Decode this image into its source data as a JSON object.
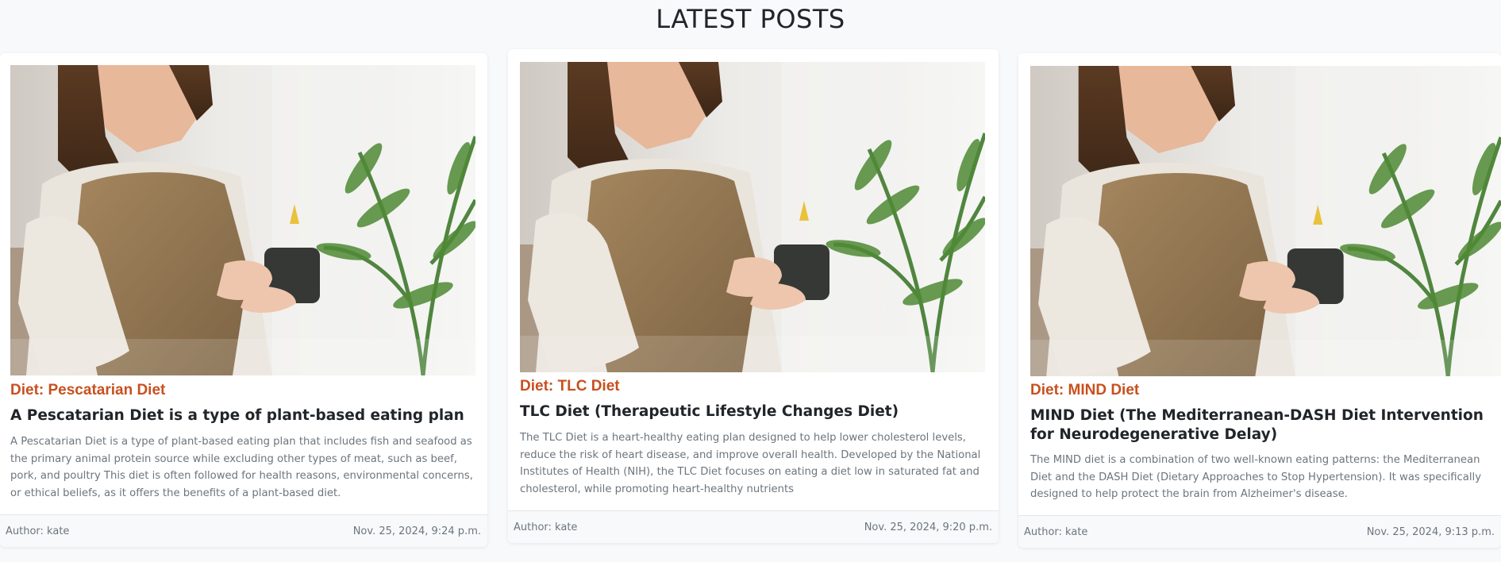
{
  "page": {
    "section_title": "LATEST POSTS"
  },
  "theme": {
    "background": "#f8f9fa",
    "category_color": "#c8501e",
    "title_color": "#212529",
    "muted_text": "#6c757d"
  },
  "posts": [
    {
      "image": "woman-holding-cup-photo",
      "category": "Diet: Pescatarian Diet",
      "title": "A Pescatarian Diet is a type of plant-based eating plan",
      "excerpt": "A Pescatarian Diet is a type of plant-based eating plan that includes fish and seafood as the primary animal protein source while excluding other types of meat, such as beef, pork, and poultry This diet is often followed for health reasons, environmental concerns, or ethical beliefs, as it offers the benefits of a plant-based diet.",
      "author": "Author: kate",
      "date": "Nov. 25, 2024, 9:24 p.m."
    },
    {
      "image": "woman-holding-cup-photo",
      "category": "Diet: TLC Diet",
      "title": "TLC Diet (Therapeutic Lifestyle Changes Diet)",
      "excerpt": "The TLC Diet is a heart-healthy eating plan designed to help lower cholesterol levels, reduce the risk of heart disease, and improve overall health. Developed by the National Institutes of Health (NIH), the TLC Diet focuses on eating a diet low in saturated fat and cholesterol, while promoting heart-healthy nutrients",
      "author": "Author: kate",
      "date": "Nov. 25, 2024, 9:20 p.m."
    },
    {
      "image": "woman-holding-cup-photo",
      "category": "Diet: MIND Diet",
      "title": "MIND Diet (The Mediterranean-DASH Diet Intervention for Neurodegenerative Delay)",
      "excerpt": "The MIND diet is a combination of two well-known eating patterns: the Mediterranean Diet and the DASH Diet (Dietary Approaches to Stop Hypertension). It was specifically designed to help protect the brain from Alzheimer's disease.",
      "author": "Author: kate",
      "date": "Nov. 25, 2024, 9:13 p.m."
    }
  ]
}
